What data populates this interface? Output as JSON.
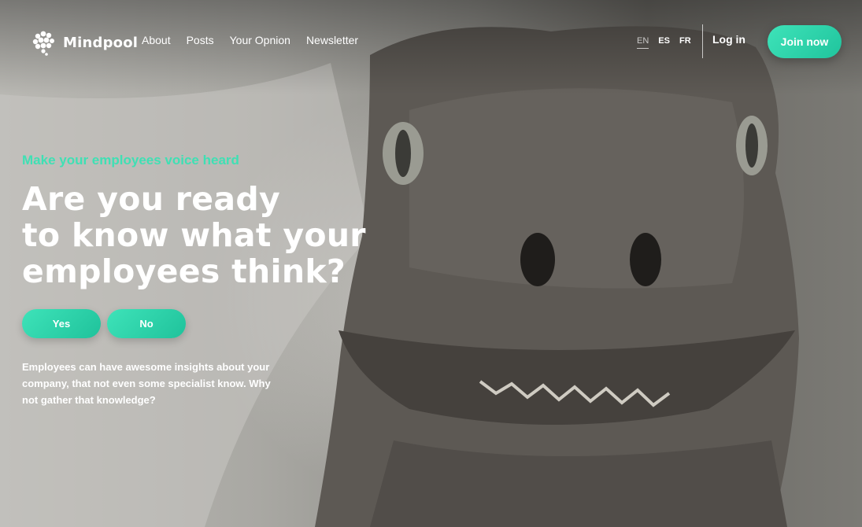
{
  "brand": {
    "name": "Mindpool",
    "logo_icon": "brain-cluster-icon"
  },
  "nav": {
    "items": [
      "About",
      "Posts",
      "Your Opnion",
      "Newsletter"
    ]
  },
  "languages": {
    "items": [
      "EN",
      "ES",
      "FR"
    ],
    "selected": "EN"
  },
  "auth": {
    "login_label": "Log in",
    "join_label": "Join now"
  },
  "hero": {
    "kicker": "Make your employees voice heard",
    "headline_lines": [
      "Are you ready",
      "to know what your",
      "employees think?"
    ],
    "yes_label": "Yes",
    "no_label": "No",
    "description": "Employees can have awesome insights about your company, that not even some specialist know. Why not gather that knowledge?"
  },
  "colors": {
    "accent": "#3EE3B9",
    "accent_dark": "#20C49D",
    "text": "#FFFFFF"
  }
}
